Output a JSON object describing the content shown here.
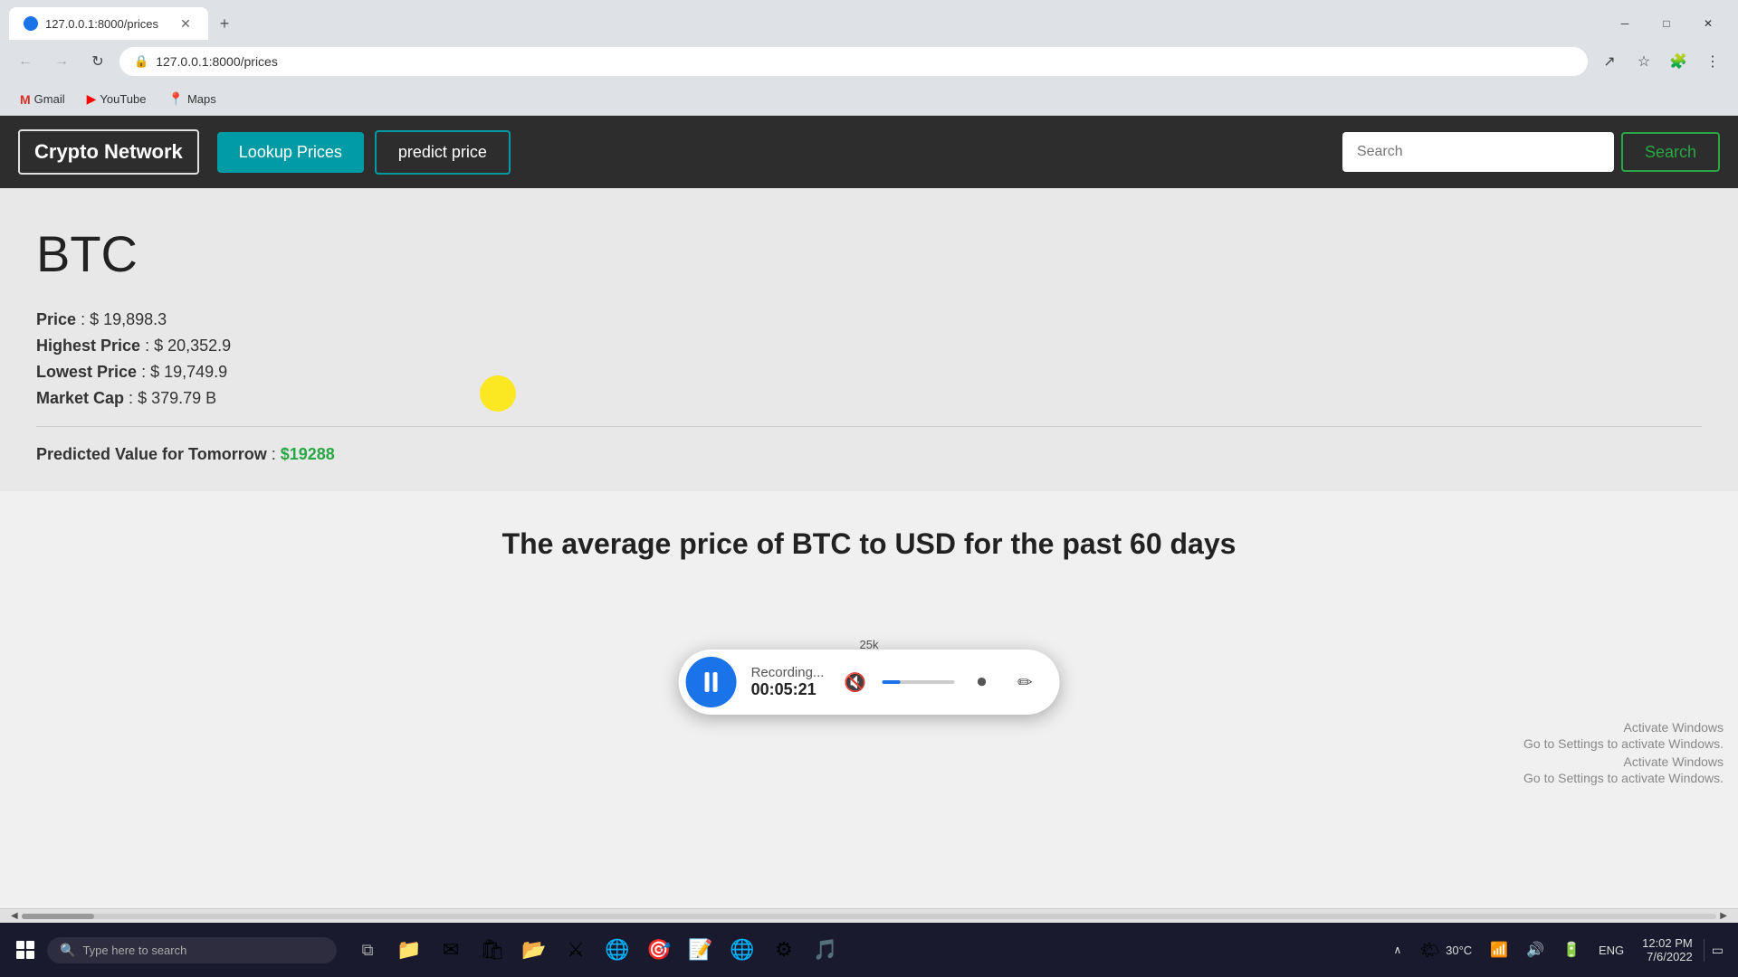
{
  "browser": {
    "tab": {
      "favicon": "●",
      "title": "127.0.0.1:8000/prices",
      "close": "✕"
    },
    "new_tab": "+",
    "window_controls": {
      "minimize": "─",
      "maximize": "□",
      "close": "✕"
    },
    "address": "127.0.0.1:8000/prices",
    "nav": {
      "back": "←",
      "forward": "→",
      "refresh": "↻"
    },
    "bookmarks": [
      {
        "name": "Gmail",
        "icon": "M"
      },
      {
        "name": "YouTube",
        "icon": "▶"
      },
      {
        "name": "Maps",
        "icon": "📍"
      }
    ],
    "toolbar": {
      "share": "↗",
      "star": "☆",
      "extensions": "🧩",
      "menu": "⋮"
    }
  },
  "navbar": {
    "brand": "Crypto Network",
    "links": [
      {
        "label": "Lookup Prices",
        "style": "filled"
      },
      {
        "label": "predict price",
        "style": "outline"
      }
    ],
    "search": {
      "placeholder": "Search",
      "button": "Search"
    }
  },
  "coin": {
    "symbol": "BTC",
    "price_label": "Price",
    "price_value": "$ 19,898.3",
    "highest_label": "Highest Price",
    "highest_value": "$ 20,352.9",
    "lowest_label": "Lowest Price",
    "lowest_value": "$ 19,749.9",
    "marketcap_label": "Market Cap",
    "marketcap_value": "$ 379.79 B",
    "predicted_label": "Predicted Value for Tomorrow",
    "predicted_value": "$19288"
  },
  "chart": {
    "title": "The average price of BTC to USD for the past 60 days",
    "y_start": "25k"
  },
  "recording": {
    "status": "Recording...",
    "time": "00:05:21"
  },
  "activate_windows": {
    "line1": "Activate Windows",
    "line2": "Go to Settings to activate Windows."
  },
  "taskbar": {
    "search_placeholder": "Type here to search",
    "apps": [
      "⊞",
      "🔵",
      "🟢",
      "📁",
      "✉",
      "🔶",
      "🗂",
      "⚔",
      "🌐",
      "🎯",
      "📝",
      "🌐",
      "⚙",
      "🎵"
    ],
    "sys_icons": [
      "🔊",
      "📶",
      "🔋"
    ],
    "temperature": "30°C",
    "time": "12:02 PM",
    "date": "7/6/2022"
  }
}
